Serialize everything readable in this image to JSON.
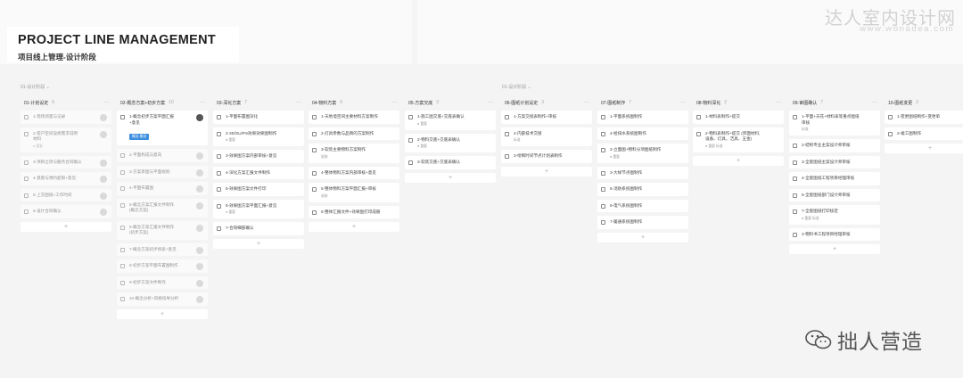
{
  "header": {
    "title": "PROJECT LINE MANAGEMENT",
    "subtitle": "项目线上管理-设计阶段",
    "watermark_text": "达人室内设计网",
    "watermark_url": "www.wonadea.com"
  },
  "footer": {
    "wechat_name": "拙人营造"
  },
  "groups": [
    {
      "label": "01-设计阶段",
      "caret": "⌄"
    },
    {
      "label": "01-设计阶段",
      "caret": "⌄"
    }
  ],
  "add_label": "+",
  "columns": [
    {
      "title": "01-计划设定",
      "count": "6",
      "menu": "···",
      "cards": [
        {
          "text": "1-现场测量与记录",
          "faded": true,
          "avatar": "light"
        },
        {
          "text": "2-客户空间设想需求说明\n材料",
          "faded": true,
          "meta": "● 重要",
          "avatar": "light"
        },
        {
          "text": "3-项目立项与服务合同确认",
          "faded": true,
          "avatar": "light"
        },
        {
          "text": "4-意愿与预约超限+意见",
          "faded": true,
          "avatar": "light"
        },
        {
          "text": "5-上交图纸+工作时间",
          "faded": true,
          "avatar": "light"
        },
        {
          "text": "6-设计合同确认",
          "faded": true,
          "avatar": "light"
        }
      ]
    },
    {
      "title": "02-概念方案+初步方案",
      "count": "10",
      "menu": "···",
      "cards": [
        {
          "text": "1-概念初步方案平面汇报\n+意见",
          "tag": "概念 概念",
          "avatar": "dark"
        },
        {
          "text": "2-平面构成与意向",
          "faded": true,
          "avatar": "light"
        },
        {
          "text": "3-方案草图与平面规划",
          "faded": true,
          "avatar": "light"
        },
        {
          "text": "4-平面布置图",
          "faded": true,
          "avatar": "light"
        },
        {
          "text": "5-概念方案汇报文件制作\n(概念方案)",
          "faded": true,
          "avatar": "light"
        },
        {
          "text": "6-概念方案汇报文件制作\n(初步方案)",
          "faded": true,
          "avatar": "light"
        },
        {
          "text": "7-概念方案初步探索+意见",
          "faded": true,
          "avatar": "light"
        },
        {
          "text": "8-初步方案平面布置图制作",
          "faded": true,
          "avatar": "light"
        },
        {
          "text": "9-初步方案文件制作",
          "faded": true,
          "avatar": "light"
        },
        {
          "text": "10-概念分析+风格指导分析",
          "faded": true,
          "avatar": "light"
        }
      ]
    },
    {
      "title": "03-深化方案",
      "count": "7",
      "menu": "···",
      "cards": [
        {
          "text": "1-平面布置图深化"
        },
        {
          "text": "2-3D/SU/PS效果效果图制作",
          "meta": "● 重要"
        },
        {
          "text": "3-效果图方案内部审核+意见"
        },
        {
          "text": "4-深化方案汇报文件制作"
        },
        {
          "text": "5-效果图方案文件打印"
        },
        {
          "text": "6-效果图方案平面汇报+意见",
          "meta": "● 重要"
        },
        {
          "text": "7-合同细部确认"
        }
      ]
    },
    {
      "title": "04-物料方案",
      "count": "6",
      "menu": "···",
      "cards": [
        {
          "text": "1-天地墙空间主要材料方案制作"
        },
        {
          "text": "2-灯具参数与品牌的方案制作"
        },
        {
          "text": "3-软装主要物料方案制作",
          "meta": "软装"
        },
        {
          "text": "4-整体物料方案内部审核+意见"
        },
        {
          "text": "5-整体物料方案平面汇报+审核",
          "meta": "软装"
        },
        {
          "text": "6-整体汇报文件+效果图打印成册"
        }
      ]
    },
    {
      "title": "05-方案交底",
      "count": "3",
      "menu": "···",
      "cards": [
        {
          "text": "1-施工图交底+交底表确认",
          "meta": "● 重要"
        },
        {
          "text": "2-物料交底+交底表确认",
          "meta": "● 重要"
        },
        {
          "text": "3-软装交底+交底表确认"
        }
      ]
    },
    {
      "title": "06-图纸计划设定",
      "count": "3",
      "menu": "···",
      "cards": [
        {
          "text": "1-方案交接表制作+审核"
        },
        {
          "text": "2-内部技术交接",
          "meta": "标准"
        },
        {
          "text": "3-绘制时间节点计划表制作"
        }
      ]
    },
    {
      "title": "07-图纸制作",
      "count": "7",
      "menu": "···",
      "cards": [
        {
          "text": "1-平面系统图制作"
        },
        {
          "text": "4-给排水系统图制作"
        },
        {
          "text": "2-立面图+物料分项图纸制作",
          "meta": "● 重要"
        },
        {
          "text": "3-大样节点图制作"
        },
        {
          "text": "5-消防系统图制作"
        },
        {
          "text": "6-电气系统图制作"
        },
        {
          "text": "7-暖通系统图制作"
        }
      ]
    },
    {
      "title": "08-物料深化",
      "count": "2",
      "menu": "···",
      "cards": [
        {
          "text": "1-材料表制作+提交"
        },
        {
          "text": "2-物料表制作+提交 (饰面材料,\n设备、灯具、洁具、五金)",
          "meta": "● 重要  标准"
        }
      ]
    },
    {
      "title": "09-审图确认",
      "count": "7",
      "menu": "···",
      "cards": [
        {
          "text": "1-平面+天花+材料表等重点图纸\n审核",
          "meta": "标准"
        },
        {
          "text": "2-结构专业主案设计师审核"
        },
        {
          "text": "3-全套图纸主案设计师审核"
        },
        {
          "text": "4-全套图纸工程项目经理审核"
        },
        {
          "text": "5-全套图纸部门设计师审核"
        },
        {
          "text": "7-全套图纸打印核定",
          "meta": "● 重要  标准"
        },
        {
          "text": "3-物料书工程项目经理审核"
        }
      ]
    },
    {
      "title": "10-图纸变更",
      "count": "2",
      "menu": "···",
      "cards": [
        {
          "text": "1-变更图纸制作+变更单"
        },
        {
          "text": "2-竣工图制作"
        }
      ]
    }
  ]
}
